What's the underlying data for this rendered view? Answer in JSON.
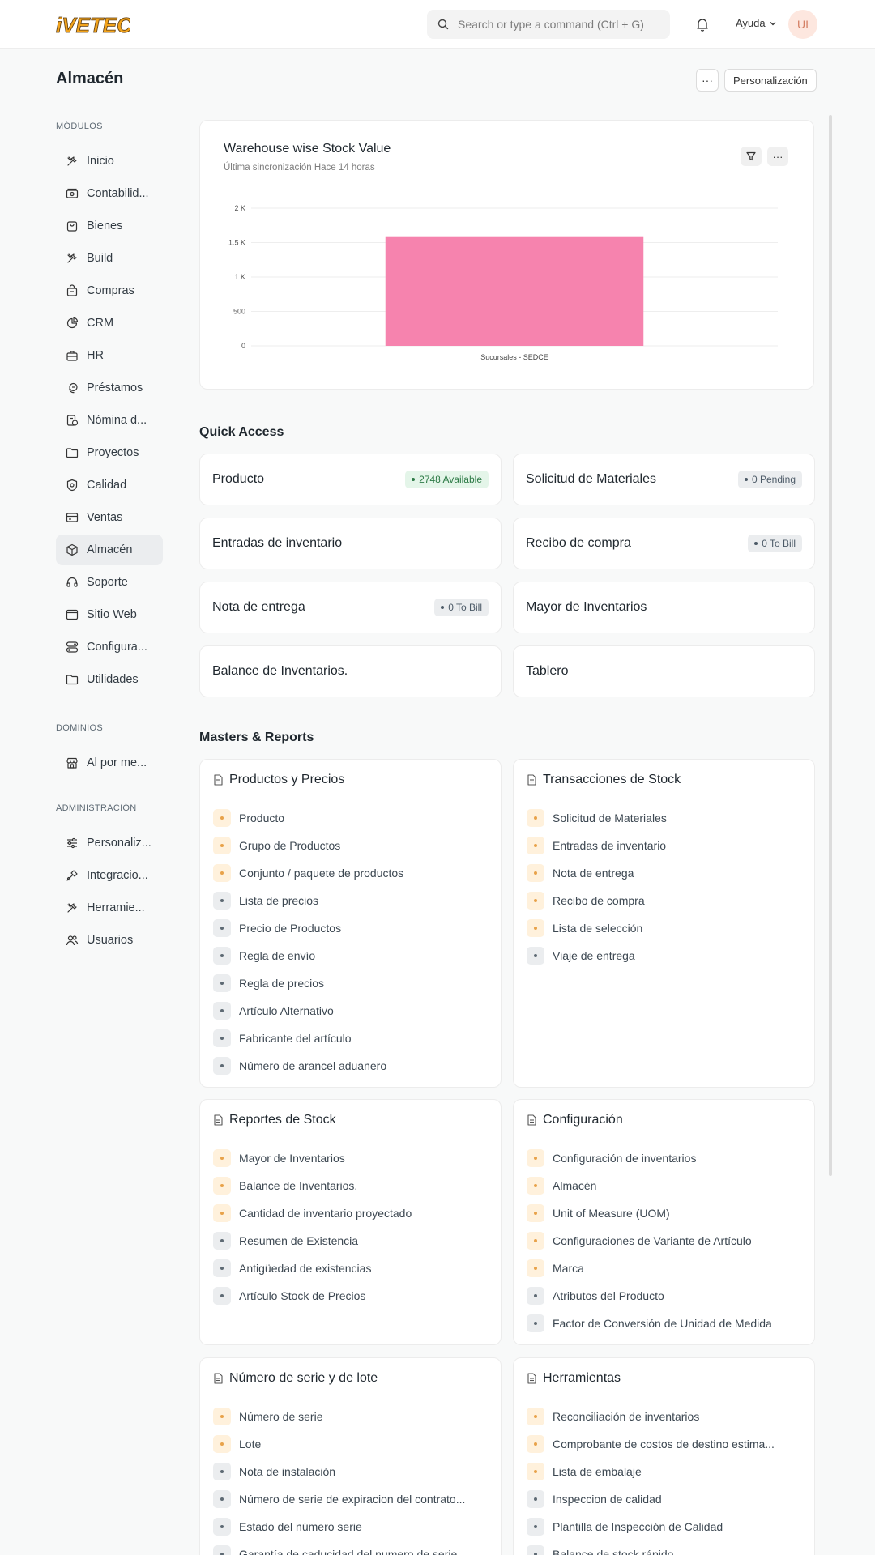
{
  "navbar": {
    "logo_text": "iVETEC",
    "search_placeholder": "Search or type a command (Ctrl + G)",
    "help_label": "Ayuda",
    "avatar_initials": "UI"
  },
  "page": {
    "title": "Almacén",
    "more_label": "···",
    "customize_label": "Personalización"
  },
  "sidebar": {
    "modules_label": "MÓDULOS",
    "modules": [
      {
        "label": "Inicio",
        "icon": "tools-icon"
      },
      {
        "label": "Contabilid...",
        "icon": "money-icon"
      },
      {
        "label": "Bienes",
        "icon": "box-icon"
      },
      {
        "label": "Build",
        "icon": "tools-icon"
      },
      {
        "label": "Compras",
        "icon": "bag-icon"
      },
      {
        "label": "CRM",
        "icon": "pie-chart-icon"
      },
      {
        "label": "HR",
        "icon": "briefcase-icon"
      },
      {
        "label": "Préstamos",
        "icon": "coins-icon"
      },
      {
        "label": "Nómina d...",
        "icon": "payroll-icon"
      },
      {
        "label": "Proyectos",
        "icon": "folder-icon"
      },
      {
        "label": "Calidad",
        "icon": "shield-icon"
      },
      {
        "label": "Ventas",
        "icon": "card-icon"
      },
      {
        "label": "Almacén",
        "icon": "cube-icon",
        "active": true
      },
      {
        "label": "Soporte",
        "icon": "headset-icon"
      },
      {
        "label": "Sitio Web",
        "icon": "browser-icon"
      },
      {
        "label": "Configura...",
        "icon": "toggle-icon"
      },
      {
        "label": "Utilidades",
        "icon": "folder-icon"
      }
    ],
    "domains_label": "DOMINIOS",
    "domains": [
      {
        "label": "Al por me...",
        "icon": "store-icon"
      }
    ],
    "admin_label": "ADMINISTRACIÓN",
    "admin": [
      {
        "label": "Personaliz...",
        "icon": "sliders-icon"
      },
      {
        "label": "Integracio...",
        "icon": "plug-icon"
      },
      {
        "label": "Herramie...",
        "icon": "tools-icon"
      },
      {
        "label": "Usuarios",
        "icon": "users-icon"
      }
    ]
  },
  "chart": {
    "title": "Warehouse wise Stock Value",
    "subtitle": "Última sincronización Hace 14 horas",
    "bar_color": "#f683ae"
  },
  "chart_data": {
    "type": "bar",
    "title": "Warehouse wise Stock Value",
    "categories": [
      "Sucursales - SEDCE"
    ],
    "values": [
      1580
    ],
    "ylim": [
      0,
      2000
    ],
    "yticks": [
      0,
      500,
      1000,
      1500,
      2000
    ],
    "ytick_labels": [
      "0",
      "500",
      "1 K",
      "1.5 K",
      "2 K"
    ],
    "grid": true
  },
  "quick_access": {
    "title": "Quick Access",
    "items": [
      {
        "label": "Producto",
        "badge": "2748 Available",
        "badge_color": "green"
      },
      {
        "label": "Solicitud de Materiales",
        "badge": "0 Pending",
        "badge_color": "gray"
      },
      {
        "label": "Entradas de inventario"
      },
      {
        "label": "Recibo de compra",
        "badge": "0 To Bill",
        "badge_color": "gray"
      },
      {
        "label": "Nota de entrega",
        "badge": "0 To Bill",
        "badge_color": "gray"
      },
      {
        "label": "Mayor de Inventarios"
      },
      {
        "label": "Balance de Inventarios."
      },
      {
        "label": "Tablero"
      }
    ]
  },
  "masters": {
    "title": "Masters & Reports",
    "cards": [
      {
        "title": "Productos y Precios",
        "items": [
          {
            "label": "Producto",
            "type": "orange"
          },
          {
            "label": "Grupo de Productos",
            "type": "orange"
          },
          {
            "label": "Conjunto / paquete de productos",
            "type": "orange"
          },
          {
            "label": "Lista de precios",
            "type": "gray"
          },
          {
            "label": "Precio de Productos",
            "type": "gray"
          },
          {
            "label": "Regla de envío",
            "type": "gray"
          },
          {
            "label": "Regla de precios",
            "type": "gray"
          },
          {
            "label": "Artículo Alternativo",
            "type": "gray"
          },
          {
            "label": "Fabricante del artículo",
            "type": "gray"
          },
          {
            "label": "Número de arancel aduanero",
            "type": "gray"
          }
        ]
      },
      {
        "title": "Transacciones de Stock",
        "items": [
          {
            "label": "Solicitud de Materiales",
            "type": "orange"
          },
          {
            "label": "Entradas de inventario",
            "type": "orange"
          },
          {
            "label": "Nota de entrega",
            "type": "orange"
          },
          {
            "label": "Recibo de compra",
            "type": "orange"
          },
          {
            "label": "Lista de selección",
            "type": "orange"
          },
          {
            "label": "Viaje de entrega",
            "type": "gray"
          }
        ]
      },
      {
        "title": "Reportes de Stock",
        "items": [
          {
            "label": "Mayor de Inventarios",
            "type": "orange"
          },
          {
            "label": "Balance de Inventarios.",
            "type": "orange"
          },
          {
            "label": "Cantidad de inventario proyectado",
            "type": "orange"
          },
          {
            "label": "Resumen de Existencia",
            "type": "gray"
          },
          {
            "label": "Antigüedad de existencias",
            "type": "gray"
          },
          {
            "label": "Artículo Stock de Precios",
            "type": "gray"
          }
        ]
      },
      {
        "title": "Configuración",
        "items": [
          {
            "label": "Configuración de inventarios",
            "type": "orange"
          },
          {
            "label": "Almacén",
            "type": "orange"
          },
          {
            "label": "Unit of Measure (UOM)",
            "type": "orange"
          },
          {
            "label": "Configuraciones de Variante de Artículo",
            "type": "orange"
          },
          {
            "label": "Marca",
            "type": "orange"
          },
          {
            "label": "Atributos del Producto",
            "type": "gray"
          },
          {
            "label": "Factor de Conversión de Unidad de Medida",
            "type": "gray"
          }
        ]
      },
      {
        "title": "Número de serie y de lote",
        "items": [
          {
            "label": "Número de serie",
            "type": "orange"
          },
          {
            "label": "Lote",
            "type": "orange"
          },
          {
            "label": "Nota de instalación",
            "type": "gray"
          },
          {
            "label": "Número de serie de expiracion del contrato...",
            "type": "gray"
          },
          {
            "label": "Estado del número serie",
            "type": "gray"
          },
          {
            "label": "Garantía de caducidad del numero de serie",
            "type": "gray"
          }
        ]
      },
      {
        "title": "Herramientas",
        "items": [
          {
            "label": "Reconciliación de inventarios",
            "type": "orange"
          },
          {
            "label": "Comprobante de costos de destino estima...",
            "type": "orange"
          },
          {
            "label": "Lista de embalaje",
            "type": "orange"
          },
          {
            "label": "Inspeccion de calidad",
            "type": "gray"
          },
          {
            "label": "Plantilla de Inspección de Calidad",
            "type": "gray"
          },
          {
            "label": "Balance de stock rápido",
            "type": "gray"
          }
        ]
      }
    ]
  }
}
